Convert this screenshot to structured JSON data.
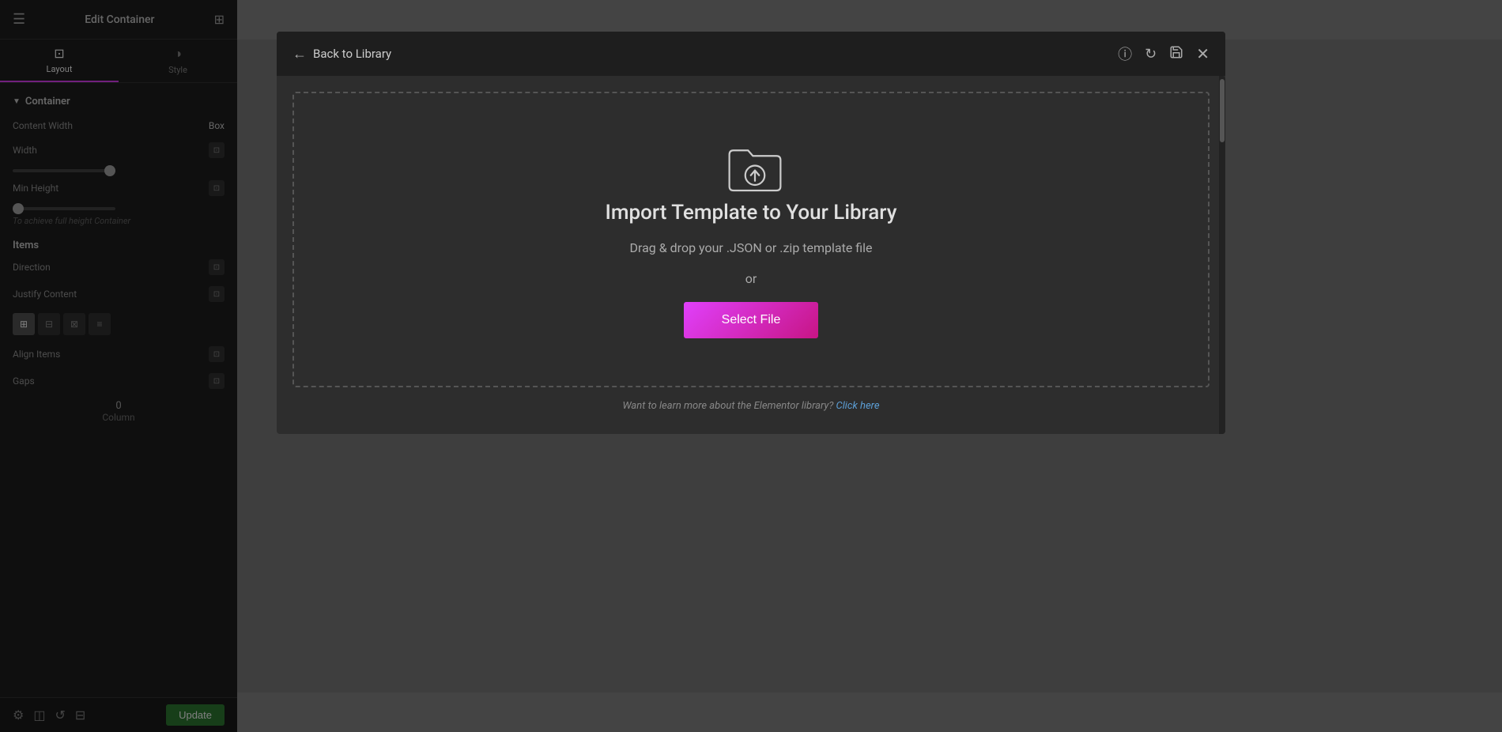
{
  "left_panel": {
    "title": "Edit Container",
    "tabs": [
      {
        "id": "layout",
        "label": "Layout",
        "active": true
      },
      {
        "id": "style",
        "label": "Style",
        "active": false
      }
    ],
    "container_section": {
      "label": "Container"
    },
    "properties": {
      "content_width_label": "Content Width",
      "content_width_value": "Box",
      "width_label": "Width",
      "min_height_label": "Min Height",
      "helper_text": "To achieve full height Container",
      "items_label": "Items",
      "direction_label": "Direction",
      "justify_content_label": "Justify Content",
      "align_items_label": "Align Items",
      "gaps_label": "Gaps",
      "gaps_value": "0",
      "column_label": "Column"
    },
    "footer": {
      "update_label": "Update"
    }
  },
  "modal": {
    "back_label": "Back to Library",
    "header_icons": {
      "info": "ℹ",
      "refresh": "↻",
      "save": "💾",
      "close": "✕"
    },
    "drop_zone": {
      "icon_label": "upload-folder-icon",
      "title": "Import Template to Your Library",
      "subtitle": "Drag & drop your .JSON or .zip template file",
      "or_label": "or",
      "select_button": "Select File"
    },
    "footer_text": "Want to learn more about the Elementor library?",
    "footer_link_label": "Click here",
    "footer_link_url": "#"
  },
  "colors": {
    "accent": "#e040fb",
    "accent_gradient_end": "#c71585",
    "link": "#5c9fd6",
    "panel_bg": "#1e1e1e",
    "modal_bg": "#2d2d2d",
    "border_dashed": "#555",
    "text_primary": "#e0e0e0",
    "text_secondary": "#aaa",
    "text_muted": "#888",
    "update_bg": "#2e7d32"
  }
}
